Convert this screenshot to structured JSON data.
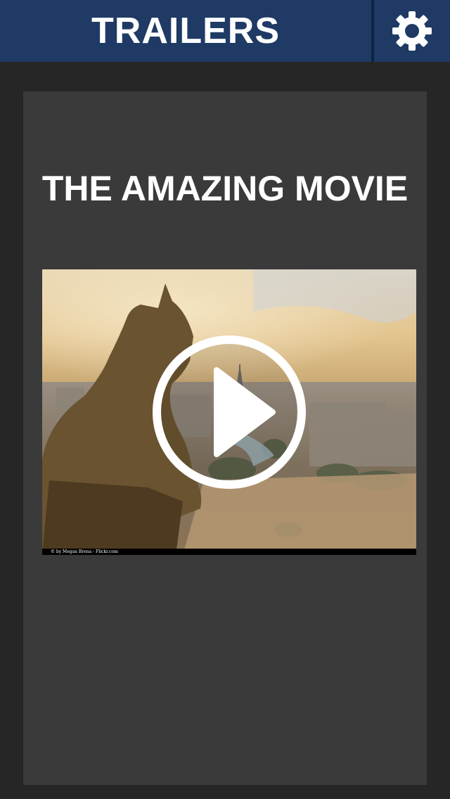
{
  "header": {
    "title": "TRAILERS",
    "settings_icon": "gear-icon",
    "background_color": "#1f3a64"
  },
  "movie": {
    "title": "THE AMAZING MOVIE",
    "thumbnail_credit": "© by Megan Brena - Flickr.com",
    "play_icon": "play-icon"
  },
  "colors": {
    "page_background": "#262626",
    "card_background": "#3a3a3a",
    "text": "#ffffff"
  }
}
